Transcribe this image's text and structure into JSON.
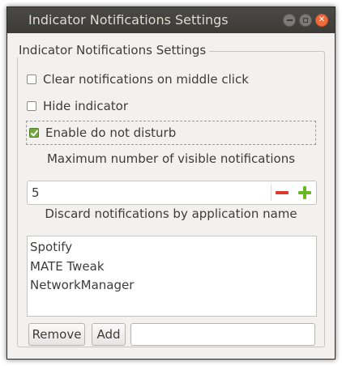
{
  "window": {
    "title": "Indicator Notifications Settings",
    "controls": {
      "minimize": "minimize-icon",
      "maximize": "maximize-icon",
      "close": "close-icon"
    }
  },
  "frame": {
    "label": "Indicator Notifications Settings"
  },
  "options": [
    {
      "label": "Clear notifications on middle click",
      "checked": false
    },
    {
      "label": "Hide indicator",
      "checked": false
    },
    {
      "label": "Enable do not disturb",
      "checked": true
    }
  ],
  "max_visible": {
    "label": "Maximum number of visible notifications",
    "value": "5"
  },
  "blacklist": {
    "label": "Discard notifications by application name",
    "items": [
      "Spotify",
      "MATE Tweak",
      "NetworkManager"
    ]
  },
  "actions": {
    "remove_label": "Remove",
    "add_label": "Add",
    "entry_value": ""
  },
  "colors": {
    "accent_check": "#74a740",
    "minus": "#df382c",
    "plus": "#68b723",
    "close": "#ef6b3b"
  }
}
